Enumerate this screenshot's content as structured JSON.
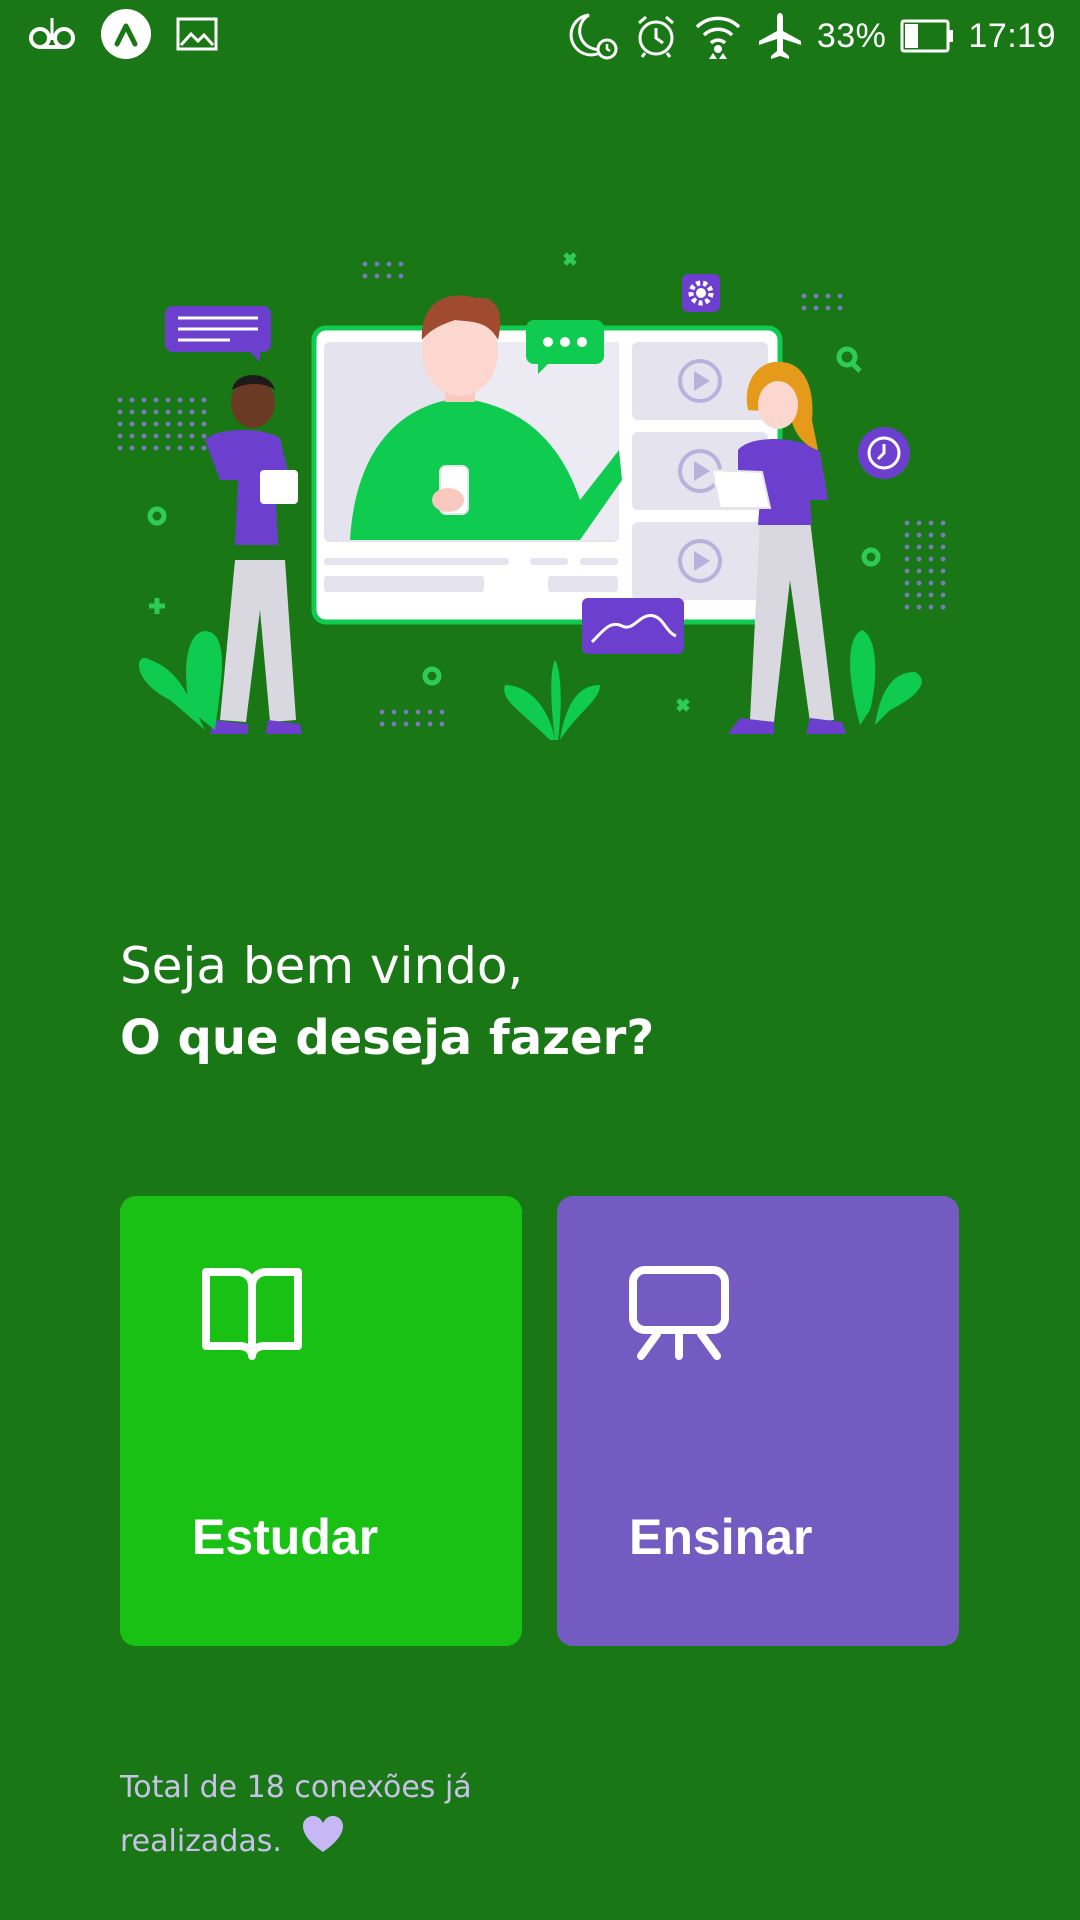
{
  "status_bar": {
    "left_icons": [
      "voicemail-icon",
      "app-badge-icon",
      "image-icon"
    ],
    "right_icons": [
      "do-not-disturb-alarm-icon",
      "alarm-icon",
      "wifi-icon",
      "airplane-mode-icon",
      "battery-icon"
    ],
    "battery_percent_text": "33%",
    "battery_level": 0.33,
    "time": "17:19"
  },
  "colors": {
    "background": "#1a7716",
    "study_card": "#19c115",
    "teach_card": "#745bc2",
    "footer_text": "#c9c2e8",
    "heart": "#c7b8f5"
  },
  "greeting": {
    "line1": "Seja bem vindo,",
    "line2": "O que deseja fazer?"
  },
  "actions": {
    "study": {
      "label": "Estudar",
      "icon": "book-open-icon"
    },
    "teach": {
      "label": "Ensinar",
      "icon": "presentation-board-icon"
    }
  },
  "footer": {
    "line1": "Total de 18 conexões já",
    "line2": "realizadas.",
    "icon": "heart-icon"
  }
}
